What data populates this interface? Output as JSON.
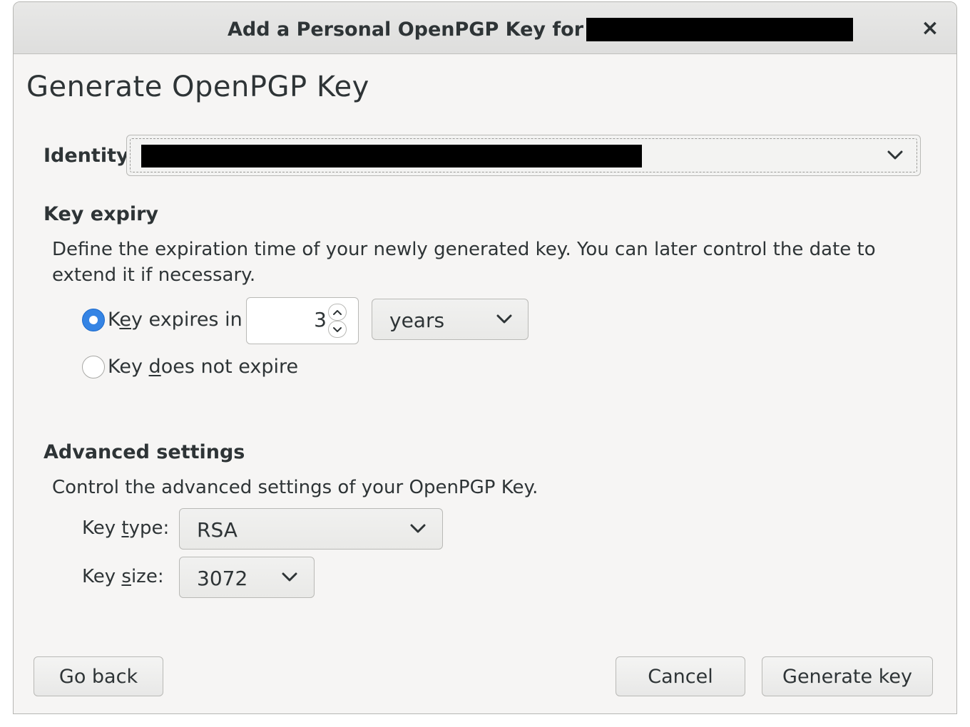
{
  "window": {
    "title": "Add a Personal OpenPGP Key for",
    "close_glyph": "×"
  },
  "page": {
    "heading": "Generate OpenPGP Key"
  },
  "identity": {
    "label": "Identity"
  },
  "expiry": {
    "heading": "Key expiry",
    "description": "Define the expiration time of your newly generated key. You can later control the date to extend it if necessary.",
    "option_expires": {
      "pre": "K",
      "underlined": "e",
      "post": "y expires in",
      "checked": true
    },
    "option_never": {
      "pre": "Key ",
      "underlined": "d",
      "post": "oes not expire",
      "checked": false
    },
    "amount": "3",
    "unit": "years"
  },
  "advanced": {
    "heading": "Advanced settings",
    "description": "Control the advanced settings of your OpenPGP Key.",
    "key_type": {
      "pre": "Key ",
      "underlined": "t",
      "post": "ype:",
      "value": "RSA"
    },
    "key_size": {
      "pre": "Key ",
      "underlined": "s",
      "post": "ize:",
      "value": "3072"
    }
  },
  "buttons": {
    "go_back": "Go back",
    "cancel": "Cancel",
    "generate": "Generate key"
  },
  "colors": {
    "accent": "#3584e4",
    "window_bg": "#f6f5f4",
    "redaction": "#000000"
  }
}
